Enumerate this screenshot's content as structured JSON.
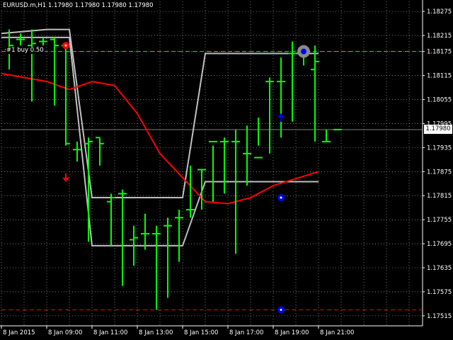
{
  "chart": {
    "symbol_text": "EURUSD.m,H1  1.17980 1.17980 1.17980 1.17980",
    "order_label": "#1 buy 0.50",
    "current_price": "1.17980",
    "colors": {
      "background": "#000000",
      "grid": "#c0c0c0",
      "candle": "#00ff00",
      "ma_line": "#ff0000",
      "envelope": "#c0c0c0",
      "buy_marker": "#0000ff",
      "sell_marker": "#ff0000",
      "bid_line": "#808080",
      "order_line": "#00ff00",
      "stop_line": "#ff0000"
    }
  },
  "chart_data": {
    "type": "candlestick",
    "price_scale": [
      "1.18275",
      "1.18215",
      "1.18175",
      "1.18115",
      "1.18055",
      "1.17995",
      "1.17935",
      "1.17875",
      "1.17815",
      "1.17755",
      "1.17695",
      "1.17635",
      "1.17575",
      "1.17515"
    ],
    "time_labels": [
      "8 Jan 2015",
      "8 Jan 09:00",
      "8 Jan 11:00",
      "8 Jan 13:00",
      "8 Jan 15:00",
      "8 Jan 17:00",
      "8 Jan 19:00",
      "8 Jan 21:00"
    ],
    "ylim": [
      1.1749,
      1.183
    ],
    "bars": [
      {
        "h": 1.1823,
        "l": 1.1813,
        "o": 1.1818,
        "c": 1.1819
      },
      {
        "h": 1.1822,
        "l": 1.1819,
        "o": 1.18205,
        "c": 1.18205
      },
      {
        "h": 1.1823,
        "l": 1.1805,
        "o": 1.1819,
        "c": 1.18195
      },
      {
        "h": 1.1821,
        "l": 1.1819,
        "o": 1.182,
        "c": 1.182
      },
      {
        "h": 1.1821,
        "l": 1.1804,
        "o": 1.18205,
        "c": 1.1819
      },
      {
        "h": 1.1819,
        "l": 1.1794,
        "o": 1.1819,
        "c": 1.17945
      },
      {
        "h": 1.1795,
        "l": 1.179,
        "o": 1.1793,
        "c": 1.1793
      },
      {
        "h": 1.1796,
        "l": 1.177,
        "o": 1.17945,
        "c": 1.1795
      },
      {
        "h": 1.1796,
        "l": 1.1789,
        "o": 1.1796,
        "c": 1.17945
      },
      {
        "h": 1.1782,
        "l": 1.1769,
        "o": 1.178,
        "c": 1.1781
      },
      {
        "h": 1.1783,
        "l": 1.1759,
        "o": 1.1782,
        "c": 1.1782
      },
      {
        "h": 1.1774,
        "l": 1.1764,
        "o": 1.17705,
        "c": 1.1771
      },
      {
        "h": 1.1777,
        "l": 1.1768,
        "o": 1.1772,
        "c": 1.1772
      },
      {
        "h": 1.1774,
        "l": 1.1753,
        "o": 1.1772,
        "c": 1.1772
      },
      {
        "h": 1.1776,
        "l": 1.1756,
        "o": 1.1774,
        "c": 1.1774
      },
      {
        "h": 1.1778,
        "l": 1.1765,
        "o": 1.1776,
        "c": 1.1776
      },
      {
        "h": 1.1789,
        "l": 1.1776,
        "o": 1.1778,
        "c": 1.1778
      },
      {
        "h": 1.1788,
        "l": 1.1778,
        "o": 1.1788,
        "c": 1.1788
      },
      {
        "h": 1.1794,
        "l": 1.178,
        "o": 1.1795,
        "c": 1.1795
      },
      {
        "h": 1.1796,
        "l": 1.1782,
        "o": 1.1795,
        "c": 1.1795
      },
      {
        "h": 1.1798,
        "l": 1.1767,
        "o": 1.1795,
        "c": 1.1795
      },
      {
        "h": 1.1799,
        "l": 1.1784,
        "o": 1.1792,
        "c": 1.1792
      },
      {
        "h": 1.1801,
        "l": 1.1794,
        "o": 1.1791,
        "c": 1.1791
      },
      {
        "h": 1.1811,
        "l": 1.1792,
        "o": 1.181,
        "c": 1.181
      },
      {
        "h": 1.1816,
        "l": 1.1796,
        "o": 1.181,
        "c": 1.181
      },
      {
        "h": 1.182,
        "l": 1.18,
        "o": 1.1817,
        "c": 1.1817
      },
      {
        "h": 1.1819,
        "l": 1.1814,
        "o": 1.1817,
        "c": 1.1817
      },
      {
        "h": 1.1819,
        "l": 1.1795,
        "o": 1.1813,
        "c": 1.1815
      },
      {
        "h": 1.1798,
        "l": 1.1795,
        "o": 1.1795,
        "c": 1.1795
      },
      {
        "h": 1.1798,
        "l": 1.1798,
        "o": 1.1798,
        "c": 1.1798
      }
    ],
    "ma": [
      1.1812,
      1.181,
      1.1808,
      1.181,
      1.1809,
      1.1802,
      1.1792,
      1.1786,
      1.178,
      1.17795,
      1.1781,
      1.1784,
      1.17875
    ],
    "envelope_upper": [
      1.1822,
      1.1823,
      1.1823,
      1.1781,
      1.1781,
      1.1781,
      1.1781,
      1.1781,
      1.1817,
      1.1817,
      1.1817,
      1.1817,
      1.1817
    ],
    "envelope_lower": [
      1.1821,
      1.1821,
      1.1821,
      1.1769,
      1.1769,
      1.1769,
      1.1769,
      1.1769,
      1.1785,
      1.1785,
      1.1785,
      1.1785,
      1.1785
    ],
    "bid_price": 1.1798,
    "order_price": 1.18175,
    "stop_price": 1.1753,
    "markers": [
      {
        "type": "sell-circle",
        "price": 1.1819,
        "bar": 5
      },
      {
        "type": "sell-arrow",
        "price": 1.1786,
        "bar": 5
      },
      {
        "type": "buy-arrow",
        "price": 1.1801,
        "bar": 24
      },
      {
        "type": "buy-circle",
        "price": 1.1781,
        "bar": 24
      },
      {
        "type": "buy-circle",
        "price": 1.1753,
        "bar": 24
      },
      {
        "type": "buy-circle-grey",
        "price": 1.18175,
        "bar": 26
      }
    ]
  }
}
